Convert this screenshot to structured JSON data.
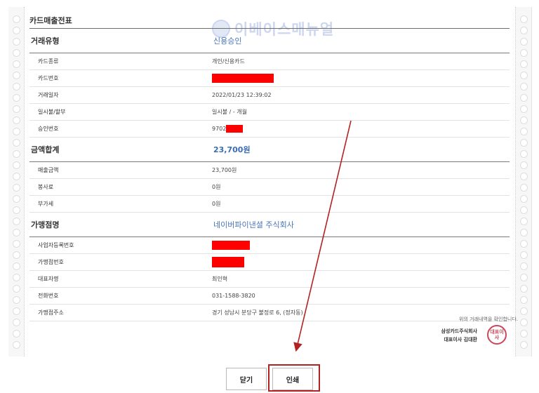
{
  "watermark": "이베이스매뉴얼",
  "doc_title": "카드매출전표",
  "transaction": {
    "label": "거래유형",
    "value": "신용승인",
    "rows": [
      {
        "label": "카드종류",
        "value": "개인/신용카드"
      },
      {
        "label": "카드번호",
        "value": ""
      },
      {
        "label": "거래일자",
        "value": "2022/01/23 12:39:02"
      },
      {
        "label": "일시불/할부",
        "value": "일시불 / - 개월"
      },
      {
        "label": "승인번호",
        "value": "9702"
      }
    ]
  },
  "amount": {
    "label": "금액합계",
    "value": "23,700원",
    "rows": [
      {
        "label": "매출금액",
        "value": "23,700원"
      },
      {
        "label": "봉사료",
        "value": "0원"
      },
      {
        "label": "부가세",
        "value": "0원"
      }
    ]
  },
  "merchant": {
    "label": "가맹점명",
    "value": "네이버파이낸셜 주식회사",
    "rows": [
      {
        "label": "사업자등록번호",
        "value": ""
      },
      {
        "label": "가맹점번호",
        "value": ""
      },
      {
        "label": "대표자명",
        "value": "최인혁"
      },
      {
        "label": "전화번호",
        "value": "031-1588-3820"
      },
      {
        "label": "가맹점주소",
        "value": "경기 성남시 분당구 불정로 6, (정자동)"
      }
    ]
  },
  "footer": {
    "confirm_text": "위의 거래내역을 확인합니다.",
    "issuer_line1": "삼성카드주식회사",
    "issuer_line2": "대표이사 김대환",
    "stamp_text": "대표이사"
  },
  "buttons": {
    "close": "닫기",
    "print": "인쇄"
  },
  "colors": {
    "accent": "#3a6db3",
    "annotation": "#b22222",
    "redaction": "#ff0000"
  }
}
